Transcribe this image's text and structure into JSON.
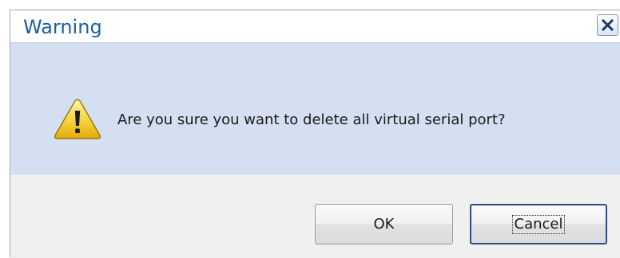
{
  "dialog": {
    "title": "Warning",
    "message": "Are you sure you want to delete all virtual serial port?",
    "icon": "warning-icon",
    "buttons": {
      "ok_label": "OK",
      "cancel_label": "Cancel"
    }
  },
  "colors": {
    "title_text": "#1e5fa8",
    "message_background": "#d4e0f1",
    "button_area_background": "#f0f0f0",
    "focused_button_border": "#2e4b85"
  }
}
